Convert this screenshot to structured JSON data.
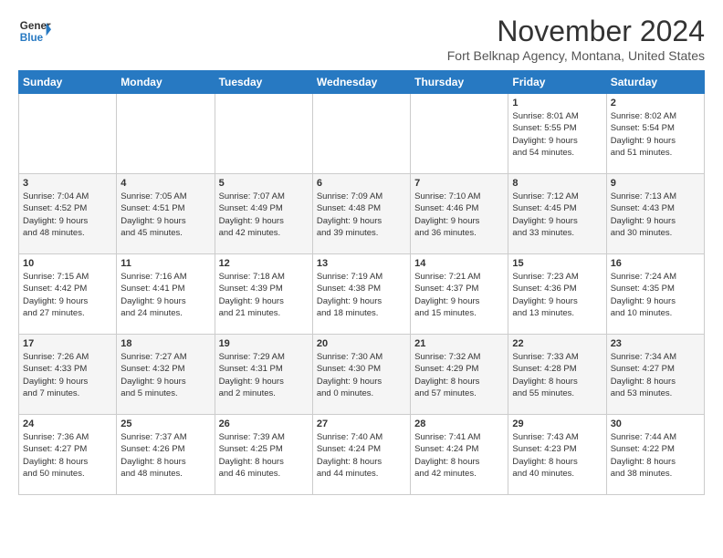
{
  "logo": {
    "line1": "General",
    "line2": "Blue"
  },
  "header": {
    "month": "November 2024",
    "location": "Fort Belknap Agency, Montana, United States"
  },
  "weekdays": [
    "Sunday",
    "Monday",
    "Tuesday",
    "Wednesday",
    "Thursday",
    "Friday",
    "Saturday"
  ],
  "weeks": [
    [
      {
        "day": "",
        "info": ""
      },
      {
        "day": "",
        "info": ""
      },
      {
        "day": "",
        "info": ""
      },
      {
        "day": "",
        "info": ""
      },
      {
        "day": "",
        "info": ""
      },
      {
        "day": "1",
        "info": "Sunrise: 8:01 AM\nSunset: 5:55 PM\nDaylight: 9 hours\nand 54 minutes."
      },
      {
        "day": "2",
        "info": "Sunrise: 8:02 AM\nSunset: 5:54 PM\nDaylight: 9 hours\nand 51 minutes."
      }
    ],
    [
      {
        "day": "3",
        "info": "Sunrise: 7:04 AM\nSunset: 4:52 PM\nDaylight: 9 hours\nand 48 minutes."
      },
      {
        "day": "4",
        "info": "Sunrise: 7:05 AM\nSunset: 4:51 PM\nDaylight: 9 hours\nand 45 minutes."
      },
      {
        "day": "5",
        "info": "Sunrise: 7:07 AM\nSunset: 4:49 PM\nDaylight: 9 hours\nand 42 minutes."
      },
      {
        "day": "6",
        "info": "Sunrise: 7:09 AM\nSunset: 4:48 PM\nDaylight: 9 hours\nand 39 minutes."
      },
      {
        "day": "7",
        "info": "Sunrise: 7:10 AM\nSunset: 4:46 PM\nDaylight: 9 hours\nand 36 minutes."
      },
      {
        "day": "8",
        "info": "Sunrise: 7:12 AM\nSunset: 4:45 PM\nDaylight: 9 hours\nand 33 minutes."
      },
      {
        "day": "9",
        "info": "Sunrise: 7:13 AM\nSunset: 4:43 PM\nDaylight: 9 hours\nand 30 minutes."
      }
    ],
    [
      {
        "day": "10",
        "info": "Sunrise: 7:15 AM\nSunset: 4:42 PM\nDaylight: 9 hours\nand 27 minutes."
      },
      {
        "day": "11",
        "info": "Sunrise: 7:16 AM\nSunset: 4:41 PM\nDaylight: 9 hours\nand 24 minutes."
      },
      {
        "day": "12",
        "info": "Sunrise: 7:18 AM\nSunset: 4:39 PM\nDaylight: 9 hours\nand 21 minutes."
      },
      {
        "day": "13",
        "info": "Sunrise: 7:19 AM\nSunset: 4:38 PM\nDaylight: 9 hours\nand 18 minutes."
      },
      {
        "day": "14",
        "info": "Sunrise: 7:21 AM\nSunset: 4:37 PM\nDaylight: 9 hours\nand 15 minutes."
      },
      {
        "day": "15",
        "info": "Sunrise: 7:23 AM\nSunset: 4:36 PM\nDaylight: 9 hours\nand 13 minutes."
      },
      {
        "day": "16",
        "info": "Sunrise: 7:24 AM\nSunset: 4:35 PM\nDaylight: 9 hours\nand 10 minutes."
      }
    ],
    [
      {
        "day": "17",
        "info": "Sunrise: 7:26 AM\nSunset: 4:33 PM\nDaylight: 9 hours\nand 7 minutes."
      },
      {
        "day": "18",
        "info": "Sunrise: 7:27 AM\nSunset: 4:32 PM\nDaylight: 9 hours\nand 5 minutes."
      },
      {
        "day": "19",
        "info": "Sunrise: 7:29 AM\nSunset: 4:31 PM\nDaylight: 9 hours\nand 2 minutes."
      },
      {
        "day": "20",
        "info": "Sunrise: 7:30 AM\nSunset: 4:30 PM\nDaylight: 9 hours\nand 0 minutes."
      },
      {
        "day": "21",
        "info": "Sunrise: 7:32 AM\nSunset: 4:29 PM\nDaylight: 8 hours\nand 57 minutes."
      },
      {
        "day": "22",
        "info": "Sunrise: 7:33 AM\nSunset: 4:28 PM\nDaylight: 8 hours\nand 55 minutes."
      },
      {
        "day": "23",
        "info": "Sunrise: 7:34 AM\nSunset: 4:27 PM\nDaylight: 8 hours\nand 53 minutes."
      }
    ],
    [
      {
        "day": "24",
        "info": "Sunrise: 7:36 AM\nSunset: 4:27 PM\nDaylight: 8 hours\nand 50 minutes."
      },
      {
        "day": "25",
        "info": "Sunrise: 7:37 AM\nSunset: 4:26 PM\nDaylight: 8 hours\nand 48 minutes."
      },
      {
        "day": "26",
        "info": "Sunrise: 7:39 AM\nSunset: 4:25 PM\nDaylight: 8 hours\nand 46 minutes."
      },
      {
        "day": "27",
        "info": "Sunrise: 7:40 AM\nSunset: 4:24 PM\nDaylight: 8 hours\nand 44 minutes."
      },
      {
        "day": "28",
        "info": "Sunrise: 7:41 AM\nSunset: 4:24 PM\nDaylight: 8 hours\nand 42 minutes."
      },
      {
        "day": "29",
        "info": "Sunrise: 7:43 AM\nSunset: 4:23 PM\nDaylight: 8 hours\nand 40 minutes."
      },
      {
        "day": "30",
        "info": "Sunrise: 7:44 AM\nSunset: 4:22 PM\nDaylight: 8 hours\nand 38 minutes."
      }
    ]
  ]
}
